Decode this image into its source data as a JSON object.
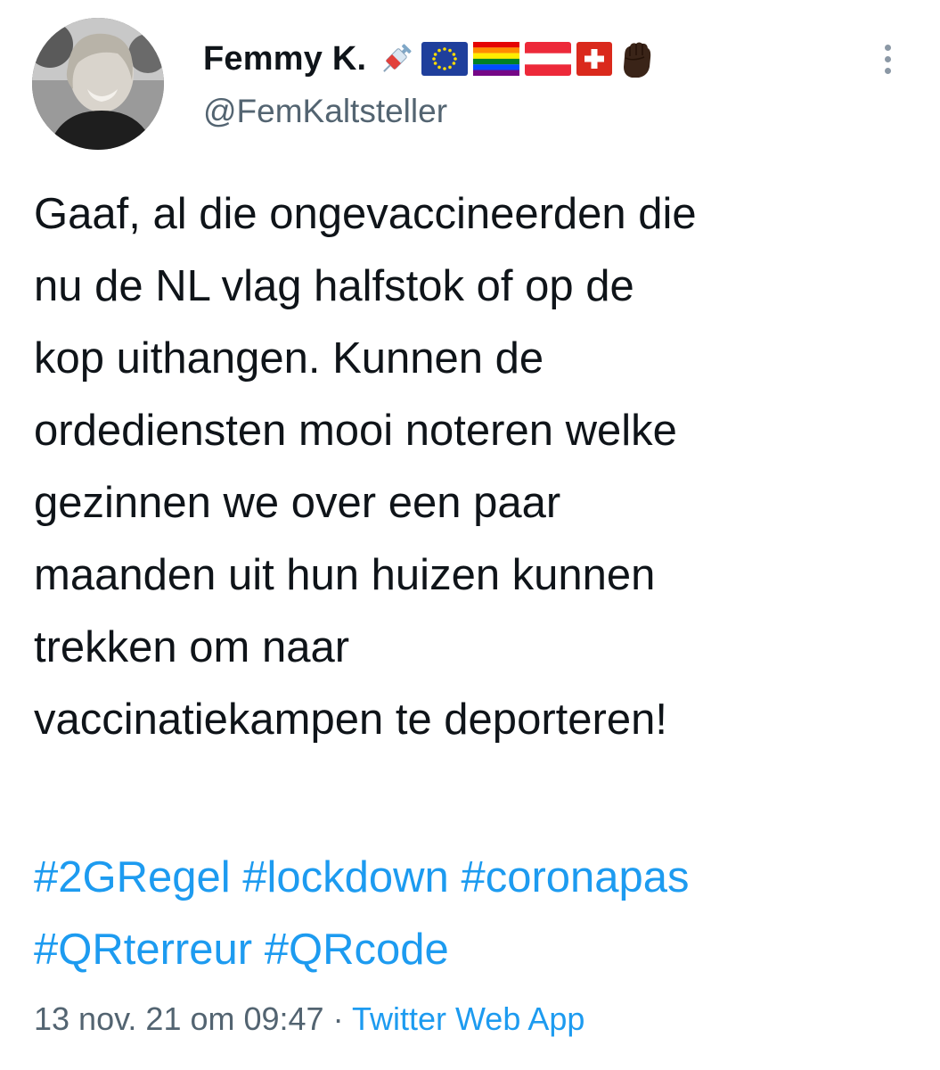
{
  "tweet": {
    "author": {
      "display_name": "Femmy K.",
      "handle": "@FemKaltsteller",
      "name_emojis": [
        "syringe",
        "eu-flag",
        "rainbow-flag",
        "austria-flag",
        "switzerland-flag",
        "raised-fist"
      ]
    },
    "text_lines": [
      "Gaaf, al die ongevaccineerden die",
      "nu de NL vlag halfstok of op de",
      "kop uithangen. Kunnen de",
      "ordediensten mooi noteren welke",
      "gezinnen we over een paar",
      "maanden uit hun huizen kunnen",
      "trekken om naar",
      "vaccinatiekampen te deporteren!"
    ],
    "hashtags": [
      "#2GRegel",
      "#lockdown",
      "#coronapas",
      "#QRterreur",
      "#QRcode"
    ],
    "timestamp": "13 nov. 21 om 09:47",
    "separator": "·",
    "source": "Twitter Web App"
  },
  "colors": {
    "text": "#0f1419",
    "secondary": "#536471",
    "link": "#1d9bf0",
    "background": "#ffffff"
  },
  "icons": {
    "more": "more-vertical-icon"
  }
}
